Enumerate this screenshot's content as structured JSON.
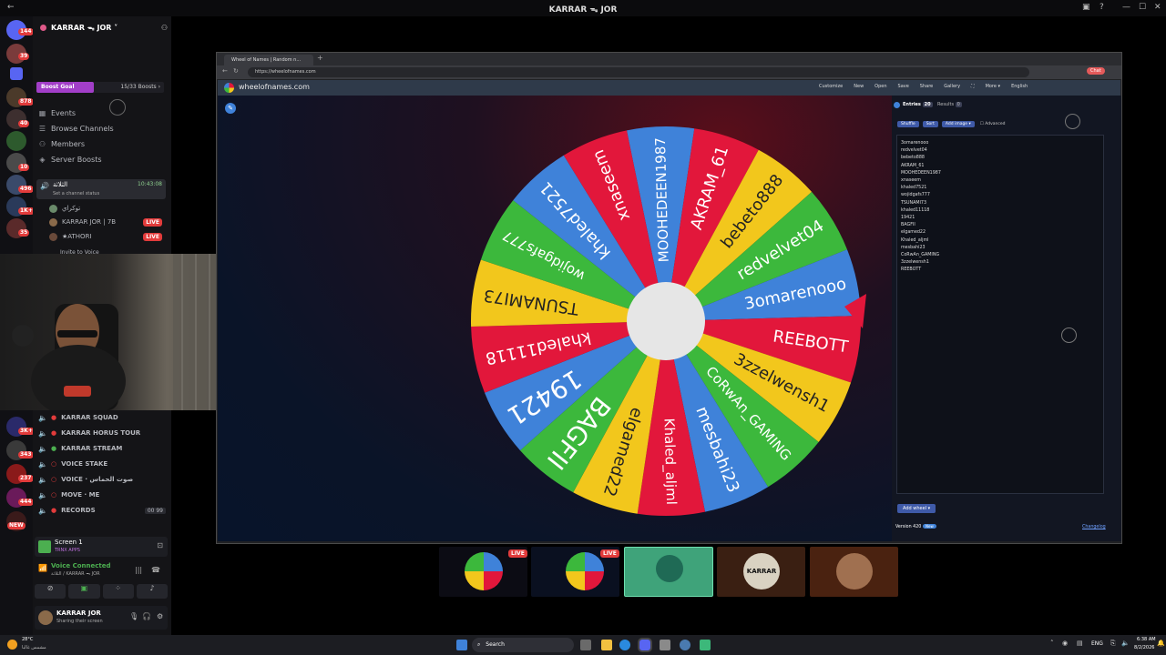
{
  "window": {
    "title": "KARRAR ᯓ JOR"
  },
  "server": {
    "name": "KARRAR ᯓ JOR ˅"
  },
  "rail_badges": [
    "144",
    "39",
    "878",
    "40",
    "10",
    "496",
    "1K+",
    "35",
    "3K+",
    "343",
    "237",
    "444",
    "NEW"
  ],
  "boost": {
    "label": "Boost Goal",
    "count": "15/33 Boosts ›",
    "progress": 0.45
  },
  "nav": [
    {
      "label": "Events",
      "icon": "calendar-icon"
    },
    {
      "label": "Browse Channels",
      "icon": "browse-icon"
    },
    {
      "label": "Members",
      "icon": "members-icon"
    },
    {
      "label": "Server Boosts",
      "icon": "boost-icon"
    }
  ],
  "voice_top": {
    "name": "الثلاثة",
    "timer": "10:43:08",
    "status": "Set a channel status"
  },
  "voice_members": [
    {
      "name": "توكراي",
      "live": ""
    },
    {
      "name": "KARRAR JOR | 7B",
      "live": "LIVE"
    },
    {
      "name": "★ATHORI",
      "live": "LIVE"
    }
  ],
  "invite": "Invite to Voice",
  "voice_channels": [
    "KARRAR SQUAD",
    "KARRAR HORUS TOUR",
    "KARRAR STREAM",
    "VOICE STAKE",
    "VOICE · صوت الحماس",
    "MOVE · ME",
    "RECORDS"
  ],
  "records_count": "00 99",
  "screen": {
    "title": "Screen 1",
    "sub": "TRNX APPS"
  },
  "voice_connected": {
    "title": "Voice Connected",
    "sub": "الثلاثة / KARRAR ᯓ JOR"
  },
  "user": {
    "name": "KARRAR JOR",
    "status": "Sharing their screen"
  },
  "browser": {
    "tab": "Wheel of Names | Random n...",
    "url": "https://wheelofnames.com",
    "profile": "Chat"
  },
  "site": {
    "logo": "wheelofnames.com",
    "menu": [
      "Customize",
      "New",
      "Open",
      "Save",
      "Share",
      "Gallery",
      "More ▾",
      "English"
    ],
    "tabs": {
      "entries": "Entries",
      "entries_count": "20",
      "results": "Results",
      "results_count": "0"
    },
    "tools": {
      "shuffle": "Shuffle",
      "sort": "Sort",
      "add_image": "Add image ▾",
      "advanced": "Advanced"
    },
    "entries": [
      "3omarenooo",
      "redvelvet04",
      "bebeto888",
      "AKRAM_61",
      "MOOHEDEEN1987",
      "xnaseem",
      "khaled7521",
      "wojidgafs777",
      "TSUNAMI73",
      "khaled11118",
      "19421",
      "BAGFII",
      "elgamed22",
      "Khaled_aljml",
      "mesbahi23",
      "CoRwAn_GAMING",
      "3zzelwensh1",
      "REEBOTT"
    ],
    "add_wheel": "Add wheel ▾",
    "version": "Version 420",
    "version_badge": "New",
    "changelog": "Changelog"
  },
  "wheel_labels": [
    "MOOHEDEEN1987",
    "AKRAM_61",
    "bebeto888",
    "redvelvet04",
    "3omarenooo",
    "REEBOTT",
    "3zzelwensh1",
    "CoRwAn_GAMING",
    "mesbahi23",
    "Khaled_aljml",
    "elgamed22",
    "BAGFII",
    "19421",
    "khaled11118",
    "TSUNAMI73",
    "wojidgafs777",
    "khaled7521",
    "xnaseem"
  ],
  "wheel_colors": [
    "#3f82d9",
    "#e2173b",
    "#f2c71c",
    "#3cb83c"
  ],
  "tiles": [
    {
      "live": "LIVE"
    },
    {
      "live": "LIVE"
    }
  ],
  "tile_names": [
    "KARRAR"
  ],
  "taskbar": {
    "weather": "28°C",
    "weather_sub": "مشمس غالبا",
    "search": "Search",
    "lang": "ENG",
    "time": "6:38 AM",
    "date": "8/2/2026"
  }
}
